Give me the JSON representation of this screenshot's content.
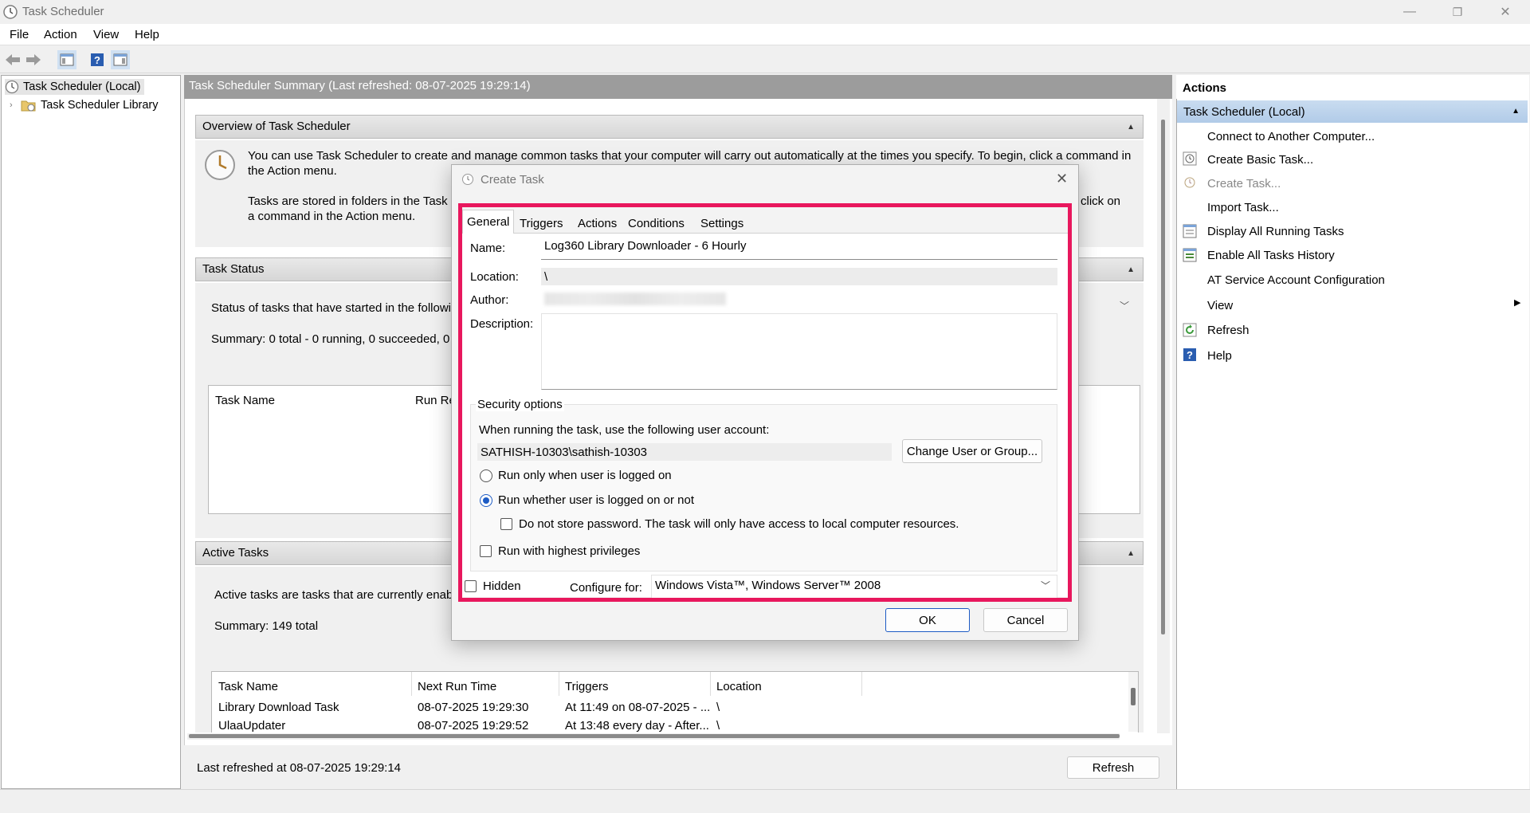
{
  "window": {
    "title": "Task Scheduler",
    "minimize": "—",
    "maximize": "❐",
    "close": "✕"
  },
  "menu": [
    "File",
    "Action",
    "View",
    "Help"
  ],
  "tree": {
    "root": "Task Scheduler (Local)",
    "library": "Task Scheduler Library"
  },
  "center": {
    "header": "Task Scheduler Summary (Last refreshed: 08-07-2025 19:29:14)",
    "overview": {
      "title": "Overview of Task Scheduler",
      "p1": "You can use Task Scheduler to create and manage common tasks that your computer will carry out automatically at the times you specify. To begin, click a command in the Action menu.",
      "p2a": "Tasks are stored in folders in the Task S",
      "p2b": "a command in the Action menu.",
      "p2c": "click on"
    },
    "status": {
      "title": "Task Status",
      "text": "Status of tasks that have started in the followin",
      "summary": "Summary: 0 total - 0 running, 0 succeeded, 0 s",
      "col_name": "Task Name",
      "col_run": "Run Re"
    },
    "active": {
      "title": "Active Tasks",
      "text": "Active tasks are tasks that are currently enable",
      "summary": "Summary: 149 total",
      "columns": [
        "Task Name",
        "Next Run Time",
        "Triggers",
        "Location"
      ],
      "rows": [
        [
          "Library Download Task",
          "08-07-2025 19:29:30",
          "At 11:49 on 08-07-2025 - ...",
          "\\"
        ],
        [
          "UlaaUpdater",
          "08-07-2025 19:29:52",
          "At 13:48 every day - After...",
          "\\"
        ]
      ]
    },
    "last_refreshed": "Last refreshed at 08-07-2025 19:29:14",
    "refresh_button": "Refresh"
  },
  "actions": {
    "title": "Actions",
    "group": "Task Scheduler (Local)",
    "items": [
      {
        "label": "Connect to Another Computer...",
        "icon": "none"
      },
      {
        "label": "Create Basic Task...",
        "icon": "clock-icon"
      },
      {
        "label": "Create Task...",
        "icon": "clock-icon"
      },
      {
        "label": "Import Task...",
        "icon": "none"
      },
      {
        "label": "Display All Running Tasks",
        "icon": "list-icon"
      },
      {
        "label": "Enable All Tasks History",
        "icon": "history-icon"
      },
      {
        "label": "AT Service Account Configuration",
        "icon": "none"
      },
      {
        "label": "View",
        "icon": "none"
      },
      {
        "label": "Refresh",
        "icon": "refresh-icon"
      },
      {
        "label": "Help",
        "icon": "help-icon"
      }
    ]
  },
  "dialog": {
    "title": "Create Task",
    "tabs": [
      "General",
      "Triggers",
      "Actions",
      "Conditions",
      "Settings"
    ],
    "name_label": "Name:",
    "name_value": "Log360 Library Downloader - 6 Hourly",
    "location_label": "Location:",
    "location_value": "\\",
    "author_label": "Author:",
    "description_label": "Description:",
    "security_title": "Security options",
    "account_prompt": "When running the task, use the following user account:",
    "account_value": "SATHISH-10303\\sathish-10303",
    "change_user_button": "Change User or Group...",
    "radio_logged_on": "Run only when user is logged on",
    "radio_whether": "Run whether user is logged on or not",
    "no_store_password": "Do not store password.  The task will only have access to local computer resources.",
    "highest_privileges": "Run with highest privileges",
    "hidden_label": "Hidden",
    "configure_label": "Configure for:",
    "configure_value": "Windows Vista™, Windows Server™ 2008",
    "ok": "OK",
    "cancel": "Cancel",
    "highlight_color": "#e8175d"
  }
}
